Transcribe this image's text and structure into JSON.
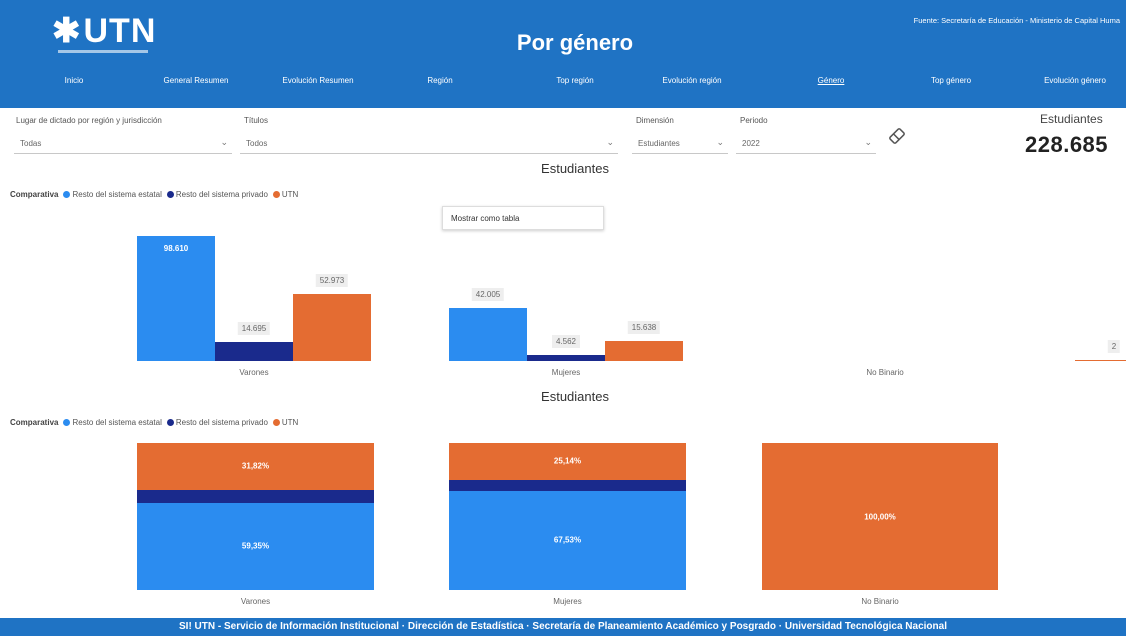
{
  "header": {
    "logo_text": "UTN",
    "title": "Por género",
    "source": "Fuente: Secretaría de Educación - Ministerio de Capital Huma",
    "nav": [
      "Inicio",
      "General Resumen",
      "Evolución Resumen",
      "Región",
      "Top región",
      "Evolución región",
      "Género",
      "Top género",
      "Evolución género"
    ],
    "active_nav": "Género"
  },
  "filters": {
    "lugar": {
      "label": "Lugar de dictado por región y jurisdicción",
      "value": "Todas"
    },
    "titulos": {
      "label": "Títulos",
      "value": "Todos"
    },
    "dimension": {
      "label": "Dimensión",
      "value": "Estudiantes"
    },
    "periodo": {
      "label": "Periodo",
      "value": "2022"
    }
  },
  "kpi": {
    "label": "Estudiantes",
    "value": "228.685"
  },
  "tooltip": "Mostrar como tabla",
  "legend": {
    "title": "Comparativa",
    "entries": [
      "Resto del sistema estatal",
      "Resto del sistema privado",
      "UTN"
    ]
  },
  "colors": {
    "estatal": "#2b8cf0",
    "privado": "#1a2a8c",
    "utn": "#e46c32",
    "header": "#1f73c4"
  },
  "chart_data": [
    {
      "type": "bar",
      "title": "Estudiantes",
      "categories": [
        "Varones",
        "Mujeres",
        "No Binario"
      ],
      "series": [
        {
          "name": "Resto del sistema estatal",
          "values": [
            98610,
            42005,
            0
          ]
        },
        {
          "name": "Resto del sistema privado",
          "values": [
            14695,
            4562,
            0
          ]
        },
        {
          "name": "UTN",
          "values": [
            52973,
            15638,
            2
          ]
        }
      ],
      "labels": [
        [
          "98.610",
          "42.005",
          ""
        ],
        [
          "14.695",
          "4.562",
          ""
        ],
        [
          "52.973",
          "15.638",
          "2"
        ]
      ],
      "ylim": [
        0,
        100000
      ]
    },
    {
      "type": "bar",
      "title": "Estudiantes",
      "stacked": "100%",
      "categories": [
        "Varones",
        "Mujeres",
        "No Binario"
      ],
      "series": [
        {
          "name": "Resto del sistema estatal",
          "values": [
            59.31,
            67.53,
            0
          ]
        },
        {
          "name": "Resto del sistema privado",
          "values": [
            8.87,
            7.33,
            0
          ]
        },
        {
          "name": "UTN",
          "values": [
            31.82,
            25.14,
            100
          ]
        }
      ],
      "labels": [
        [
          "59,35%",
          "67,53%",
          ""
        ],
        [
          "",
          "",
          ""
        ],
        [
          "31,82%",
          "25,14%",
          "100,00%"
        ]
      ]
    }
  ],
  "footer": {
    "brand": "SI! UTN",
    "text": " - Servicio de Información Institucional · Dirección de Estadística · Secretaría de Planeamiento Académico y Posgrado · Universidad Tecnológica Nacional"
  }
}
